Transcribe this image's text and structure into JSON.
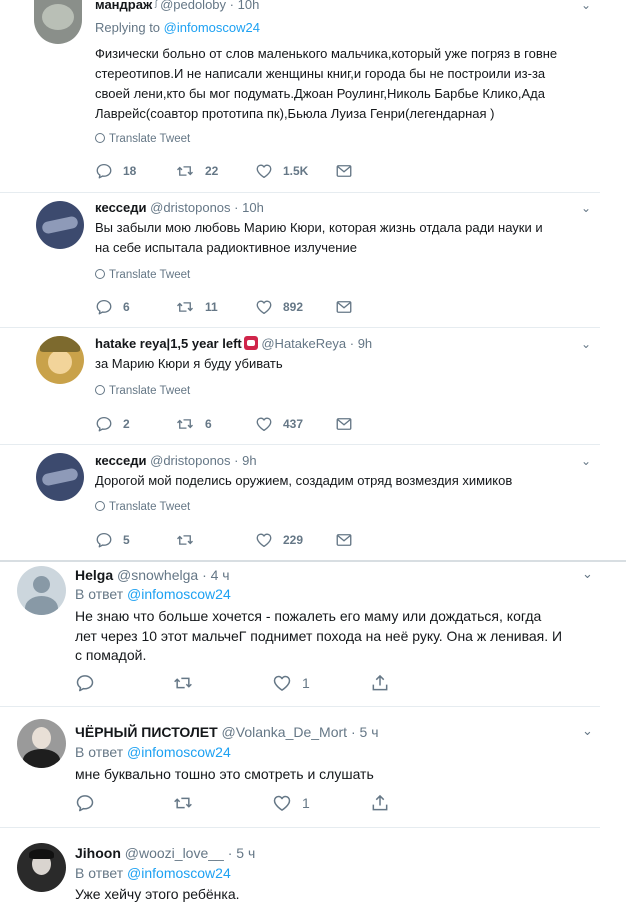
{
  "tweets": [
    {
      "name": "мандраж",
      "verified_mark": "ᶴ",
      "handle": "@pedoloby",
      "dot": "·",
      "time": "10h",
      "reply_prefix": "Replying to",
      "reply_to": "@infomoscow24",
      "text": "Физически больно от слов маленького мальчика,который уже погряз в говне\nстереотипов.И не написали женщины книг,и города бы не построили из-за\nсвоей лени,кто бы мог подумать.Джоан Роулинг,Николь Барбье Клико,Ада\nЛаврейс(соавтор прототипа пк),Бьюла Луиза Генри(легендарная )",
      "translate": "Translate Tweet",
      "replies": "18",
      "retweets": "22",
      "likes": "1.5K",
      "avatar_color": "#8a8f8a"
    },
    {
      "name": "кесседи",
      "handle": "@dristoponos",
      "dot": "·",
      "time": "10h",
      "text": "Вы забыли мою любовь Марию Кюри, которая жизнь отдала ради науки и\nна себе испытала радиоктивное излучение",
      "translate": "Translate Tweet",
      "replies": "6",
      "retweets": "11",
      "likes": "892",
      "avatar_color": "#3c4a6e"
    },
    {
      "name": "hatake reya|1,5 year left",
      "handle": "@HatakeReya",
      "dot": "·",
      "time": "9h",
      "text": "за Марию Кюри я буду убивать",
      "translate": "Translate Tweet",
      "replies": "2",
      "retweets": "6",
      "likes": "437",
      "avatar_color": "#c9a24a"
    },
    {
      "name": "кесседи",
      "handle": "@dristoponos",
      "dot": "·",
      "time": "9h",
      "text": "Дорогой мой поделись оружием, создадим отряд возмездия химиков",
      "translate": "Translate Tweet",
      "replies": "5",
      "retweets": "",
      "likes": "229",
      "avatar_color": "#3c4a6e"
    },
    {
      "name": "Helga",
      "handle": "@snowhelga",
      "dot": "·",
      "time": "4 ч",
      "reply_prefix": "В ответ",
      "reply_to": "@infomoscow24",
      "text": "Не знаю что больше хочется - пожалеть его  маму или дождаться,  когда\nлет через 10 этот мальчеГ поднимет похода на неё руку. Она ж ленивая.  И\nс помадой.",
      "likes": "1",
      "avatar_color": "#ccd6dd"
    },
    {
      "name": "ЧЁРНЫЙ ПИСТОЛЕТ",
      "handle": "@Volanka_De_Mort",
      "dot": "·",
      "time": "5 ч",
      "reply_prefix": "В ответ",
      "reply_to": "@infomoscow24",
      "text": "мне буквально тошно это смотреть и слушать",
      "likes": "1",
      "avatar_color": "#9a9a9a"
    },
    {
      "name": "Jihoon",
      "handle": "@woozi_love__",
      "dot": "·",
      "time": "5 ч",
      "reply_prefix": "В ответ",
      "reply_to": "@infomoscow24",
      "text": "Уже хейчу этого ребёнка.",
      "avatar_color": "#2a2a2a"
    }
  ],
  "icons": {
    "reply": "reply-icon",
    "retweet": "retweet-icon",
    "like": "heart-icon",
    "dm": "envelope-icon",
    "share": "share-icon",
    "caret": "chevron-down-icon",
    "globe": "globe-icon"
  },
  "colors": {
    "link": "#1da1f2",
    "secondary": "#657786",
    "divider": "#e6ecf0"
  }
}
